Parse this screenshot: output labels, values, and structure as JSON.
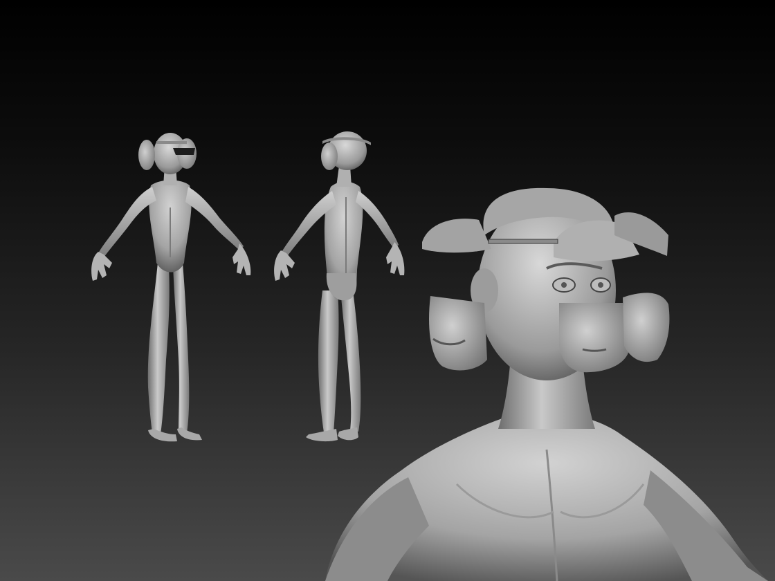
{
  "scene": {
    "background_top": "#000000",
    "background_bottom": "#4a4a4a",
    "material_light": "#c8c8c8",
    "material_mid": "#8f8f8f",
    "material_dark": "#3a3a3a"
  }
}
